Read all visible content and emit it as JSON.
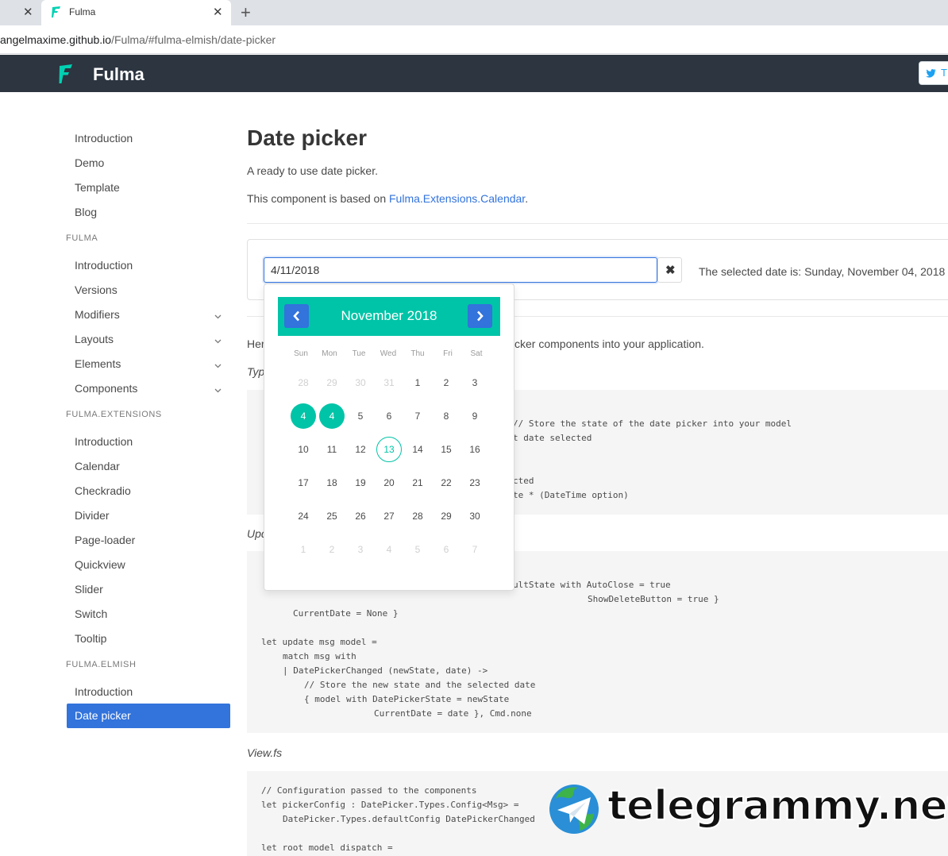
{
  "browser": {
    "tab_label": "Fulma",
    "url_host": "angelmaxime.github.io",
    "url_path": "/Fulma/#fulma-elmish/date-picker"
  },
  "navbar": {
    "brand": "Fulma",
    "tweet_label": "T"
  },
  "sidebar": {
    "top_items": [
      "Introduction",
      "Demo",
      "Template",
      "Blog"
    ],
    "sections": [
      {
        "label": "FULMA",
        "items": [
          "Introduction",
          "Versions",
          "Modifiers",
          "Layouts",
          "Elements",
          "Components"
        ]
      },
      {
        "label": "FULMA.EXTENSIONS",
        "items": [
          "Introduction",
          "Calendar",
          "Checkradio",
          "Divider",
          "Page-loader",
          "Quickview",
          "Slider",
          "Switch",
          "Tooltip"
        ]
      },
      {
        "label": "FULMA.ELMISH",
        "items": [
          "Introduction",
          "Date picker"
        ]
      }
    ],
    "active_item": "Date picker"
  },
  "main": {
    "title": "Date picker",
    "subtitle": "A ready to use date picker.",
    "based_on_prefix": "This component is based on ",
    "based_on_link": "Fulma.Extensions.Calendar",
    "based_on_suffix": ".",
    "input_value": "4/11/2018",
    "clear_icon": "✖",
    "selected_text": "The selected date is: Sunday, November 04, 2018",
    "intro_prefix": "Her",
    "intro_suffix": "cker components into your application.",
    "types_label": "Typ",
    "update_label": "Upd",
    "view_label": "View.fs",
    "code_types": [
      "// Store the state of the date picker into your model",
      "t date selected",
      "cted",
      "te * (DateTime option)"
    ],
    "code_update": [
      "ultState with AutoClose = true",
      "ShowDeleteButton = true }",
      "CurrentDate = None }",
      "let update msg model =",
      "match msg with",
      "| DatePickerChanged (newState, date) ->",
      "// Store the new state and the selected date",
      "{ model with DatePickerState = newState",
      "CurrentDate = date }, Cmd.none"
    ],
    "code_view": [
      "// Configuration passed to the components",
      "let pickerConfig : DatePicker.Types.Config<Msg> =",
      "DatePicker.Types.defaultConfig DatePickerChanged",
      "let root model dispatch ="
    ]
  },
  "calendar": {
    "month_label": "November 2018",
    "weekdays": [
      "Sun",
      "Mon",
      "Tue",
      "Wed",
      "Thu",
      "Fri",
      "Sat"
    ],
    "weeks": [
      [
        "28",
        "29",
        "30",
        "31",
        "1",
        "2",
        "3"
      ],
      [
        "4",
        "4",
        "5",
        "6",
        "7",
        "8",
        "9"
      ],
      [
        "10",
        "11",
        "12",
        "13",
        "14",
        "15",
        "16"
      ],
      [
        "17",
        "18",
        "19",
        "20",
        "21",
        "22",
        "23"
      ],
      [
        "24",
        "25",
        "26",
        "27",
        "28",
        "29",
        "30"
      ],
      [
        "1",
        "2",
        "3",
        "4",
        "5",
        "6",
        "7"
      ]
    ],
    "accent_color": "#00c4a7",
    "nav_color": "#3273dc"
  },
  "watermark": "telegrammy.net"
}
